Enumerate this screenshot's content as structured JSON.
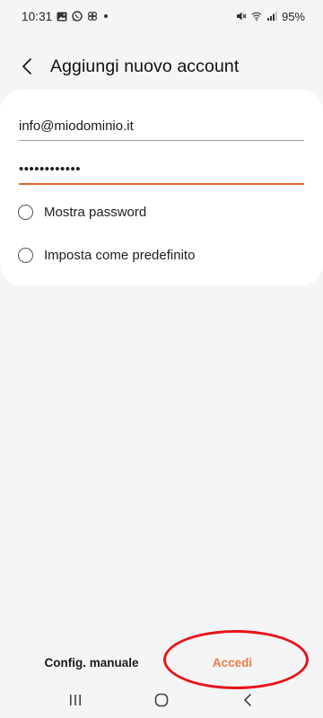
{
  "status_bar": {
    "time": "10:31",
    "battery": "95%",
    "left_icons": [
      "gallery-icon",
      "whatsapp-icon",
      "pinwheel-icon"
    ],
    "right_icons": [
      "mute-icon",
      "wifi-icon",
      "signal-icon"
    ]
  },
  "header": {
    "title": "Aggiungi nuovo account"
  },
  "form": {
    "email_value": "info@miodominio.it",
    "password_value": "••••••••••••",
    "show_password_label": "Mostra password",
    "set_default_label": "Imposta come predefinito"
  },
  "actions": {
    "manual_config_label": "Config. manuale",
    "login_label": "Accedi"
  },
  "colors": {
    "accent": "#e4632a",
    "login_text": "#ef7a45",
    "highlight": "#e8141a",
    "background": "#f5f5f5",
    "card": "#ffffff"
  }
}
